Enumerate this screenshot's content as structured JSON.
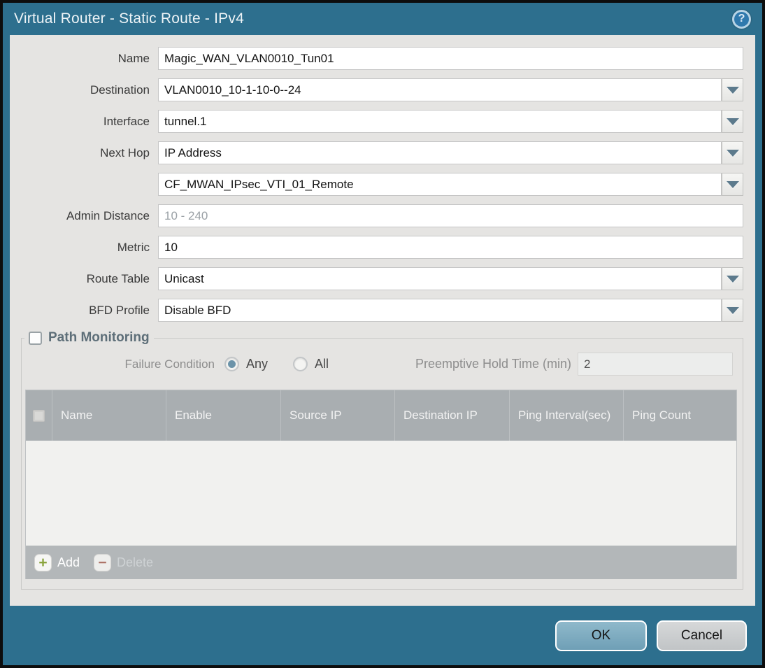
{
  "titlebar": {
    "title": "Virtual Router - Static Route - IPv4",
    "help_glyph": "?"
  },
  "form": {
    "name": {
      "label": "Name",
      "value": "Magic_WAN_VLAN0010_Tun01"
    },
    "destination": {
      "label": "Destination",
      "value": "VLAN0010_10-1-10-0--24"
    },
    "interface": {
      "label": "Interface",
      "value": "tunnel.1"
    },
    "next_hop": {
      "label": "Next Hop",
      "value": "IP Address"
    },
    "next_hop_address": {
      "value": "CF_MWAN_IPsec_VTI_01_Remote"
    },
    "admin_distance": {
      "label": "Admin Distance",
      "value": "",
      "placeholder": "10 - 240"
    },
    "metric": {
      "label": "Metric",
      "value": "10"
    },
    "route_table": {
      "label": "Route Table",
      "value": "Unicast"
    },
    "bfd_profile": {
      "label": "BFD Profile",
      "value": "Disable BFD"
    }
  },
  "path_monitoring": {
    "title": "Path Monitoring",
    "checked": false,
    "failure_condition": {
      "label": "Failure Condition",
      "options": [
        "Any",
        "All"
      ],
      "selected": "Any"
    },
    "preemptive_hold_time": {
      "label": "Preemptive Hold Time (min)",
      "value": "2"
    },
    "table": {
      "columns": [
        "Name",
        "Enable",
        "Source IP",
        "Destination IP",
        "Ping Interval(sec)",
        "Ping Count"
      ],
      "rows": []
    },
    "toolbar": {
      "add_label": "Add",
      "delete_label": "Delete",
      "add_glyph": "+",
      "delete_glyph": "−",
      "delete_enabled": false
    }
  },
  "footer": {
    "ok_label": "OK",
    "cancel_label": "Cancel"
  },
  "colors": {
    "frame_teal": "#2d6f8e",
    "content_bg": "#e5e4e2",
    "table_header_bg": "#a9aeb1",
    "table_footer_bg": "#b3b7b9",
    "ok_button": "#79a9bf",
    "cancel_button": "#c8cbcd",
    "radio_selected": "#6b93a9",
    "add_icon_green": "#8aa43c",
    "delete_icon_red": "#ad7468"
  }
}
